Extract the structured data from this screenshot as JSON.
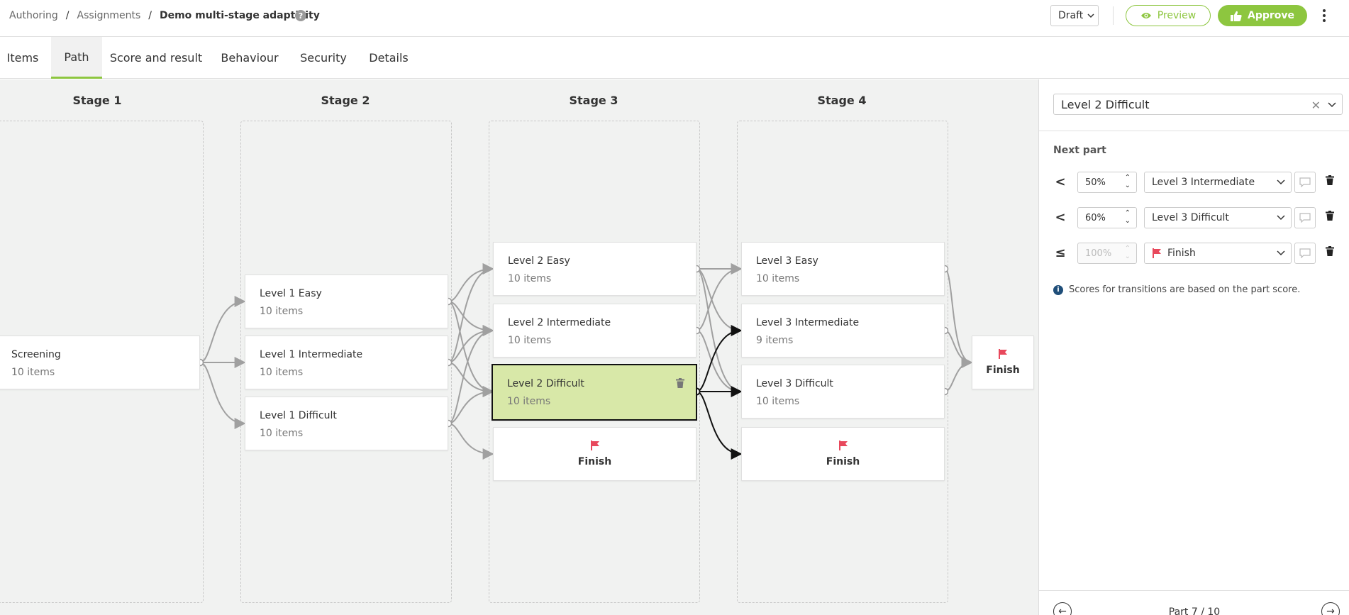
{
  "breadcrumb": {
    "items": [
      "Authoring",
      "Assignments"
    ],
    "current": "Demo multi-stage adaptivity",
    "separator": "/"
  },
  "header": {
    "status": "Draft",
    "preview_label": "Preview",
    "approve_label": "Approve",
    "accent": "#8dc63f"
  },
  "tabs": [
    {
      "label": "Items"
    },
    {
      "label": "Path",
      "active": true
    },
    {
      "label": "Score and result"
    },
    {
      "label": "Behaviour"
    },
    {
      "label": "Security"
    },
    {
      "label": "Details"
    }
  ],
  "stages": [
    {
      "title": "Stage 1"
    },
    {
      "title": "Stage 2"
    },
    {
      "title": "Stage 3"
    },
    {
      "title": "Stage 4"
    }
  ],
  "nodes": {
    "screening": {
      "title": "Screening",
      "count": "10 items"
    },
    "l1_easy": {
      "title": "Level 1 Easy",
      "count": "10 items"
    },
    "l1_int": {
      "title": "Level 1 Intermediate",
      "count": "10 items"
    },
    "l1_diff": {
      "title": "Level 1 Difficult",
      "count": "10 items"
    },
    "l2_easy": {
      "title": "Level 2 Easy",
      "count": "10 items"
    },
    "l2_int": {
      "title": "Level 2 Intermediate",
      "count": "10 items"
    },
    "l2_diff": {
      "title": "Level 2 Difficult",
      "count": "10 items",
      "selected": true
    },
    "finish_s3": {
      "title": "Finish"
    },
    "l3_easy": {
      "title": "Level 3 Easy",
      "count": "10 items"
    },
    "l3_int": {
      "title": "Level 3 Intermediate",
      "count": "9 items"
    },
    "l3_diff": {
      "title": "Level 3 Difficult",
      "count": "10 items"
    },
    "finish_s4": {
      "title": "Finish"
    },
    "finish_end": {
      "title": "Finish"
    }
  },
  "panel": {
    "selected_part": "Level 2 Difficult",
    "next_part_label": "Next part",
    "rules": [
      {
        "op": "<",
        "percent": "50%",
        "target": "Level 3 Intermediate",
        "disabled": false
      },
      {
        "op": "<",
        "percent": "60%",
        "target": "Level 3 Difficult",
        "disabled": false
      },
      {
        "op": "≤",
        "percent": "100%",
        "target": "Finish",
        "disabled": true,
        "flag": true
      }
    ],
    "info_text": "Scores for transitions are based on the part score.",
    "pager_text": "Part 7 / 10"
  },
  "colors": {
    "selected_fill": "#d8e8a8",
    "flag": "#e8485c",
    "edge_gray": "#a0a0a0",
    "edge_active": "#111111"
  }
}
